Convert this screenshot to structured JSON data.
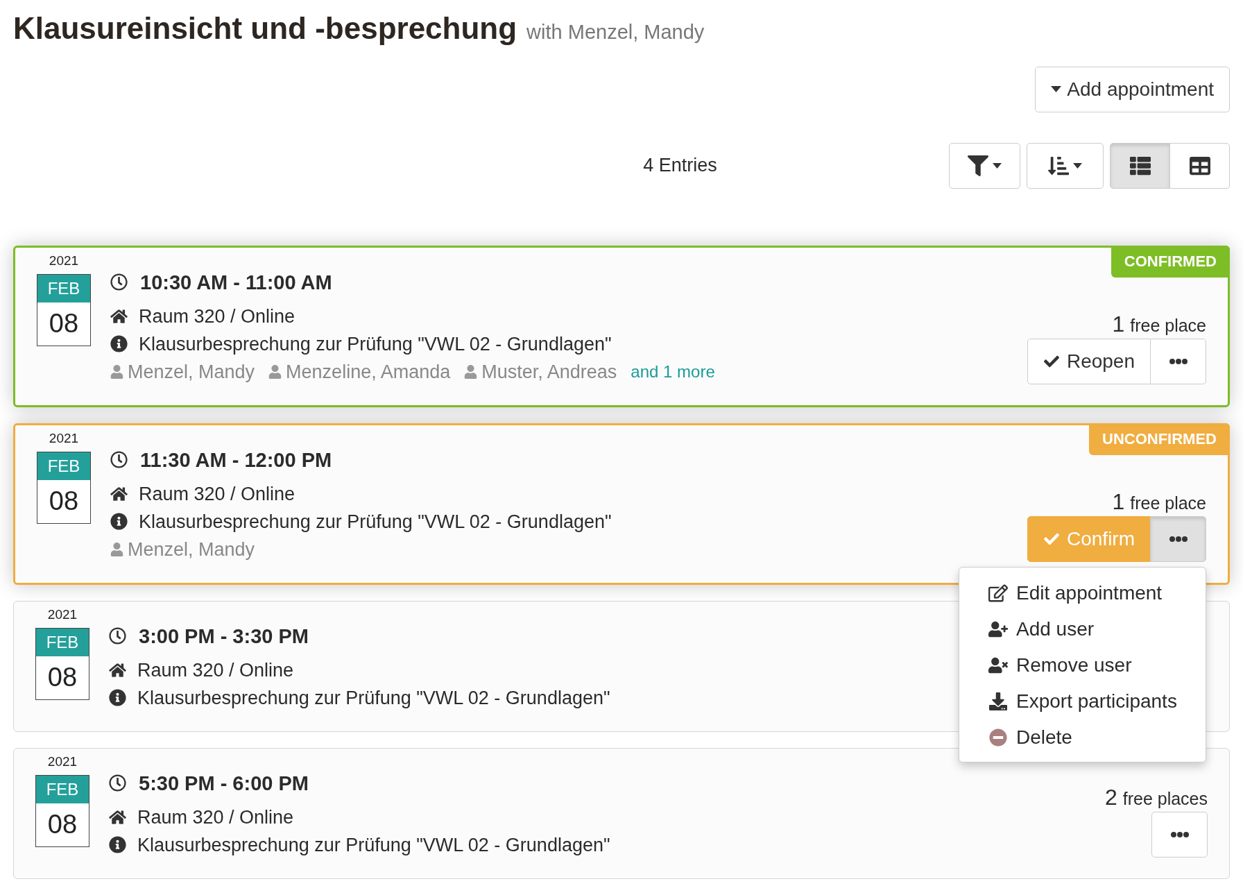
{
  "header": {
    "title": "Klausureinsicht und -besprechung",
    "subtitle": "with Menzel, Mandy"
  },
  "add_button": {
    "label": "Add appointment"
  },
  "toolbar": {
    "count": "4 Entries",
    "buttons": [
      {
        "kind": "filter"
      },
      {
        "kind": "sort"
      }
    ],
    "views": [
      {
        "kind": "list",
        "selected": true
      },
      {
        "kind": "table",
        "selected": false
      }
    ]
  },
  "appointments": [
    {
      "status": {
        "label": "CONFIRMED",
        "color": "#7dbd26"
      },
      "year": "2021",
      "month": "FEB",
      "day": "08",
      "time": "10:30 AM - 11:00 AM",
      "location": "Raum 320 / Online",
      "description": "Klausurbesprechung zur Prüfung \"VWL 02 - Grundlagen\"",
      "participants": [
        "Menzel, Mandy",
        "Menzeline, Amanda",
        "Muster, Andreas"
      ],
      "more": "and 1 more",
      "free": {
        "count": "1",
        "label": "free place"
      },
      "action": {
        "kind": "reopen",
        "label": "Reopen"
      },
      "menu_open": false
    },
    {
      "status": {
        "label": "UNCONFIRMED",
        "color": "#f0ad40"
      },
      "year": "2021",
      "month": "FEB",
      "day": "08",
      "time": "11:30 AM - 12:00 PM",
      "location": "Raum 320 / Online",
      "description": "Klausurbesprechung zur Prüfung \"VWL 02 - Grundlagen\"",
      "participants": [
        "Menzel, Mandy"
      ],
      "free": {
        "count": "1",
        "label": "free place"
      },
      "action": {
        "kind": "confirm",
        "label": "Confirm"
      },
      "menu_open": true,
      "menu": [
        {
          "kind": "edit",
          "label": "Edit appointment"
        },
        {
          "kind": "add-user",
          "label": "Add user"
        },
        {
          "kind": "remove-user",
          "label": "Remove user"
        },
        {
          "kind": "export",
          "label": "Export participants"
        },
        {
          "kind": "delete",
          "label": "Delete"
        }
      ]
    },
    {
      "year": "2021",
      "month": "FEB",
      "day": "08",
      "time": "3:00 PM - 3:30 PM",
      "location": "Raum 320 / Online",
      "description": "Klausurbesprechung zur Prüfung \"VWL 02 - Grundlagen\""
    },
    {
      "year": "2021",
      "month": "FEB",
      "day": "08",
      "time": "5:30 PM - 6:00 PM",
      "location": "Raum 320 / Online",
      "description": "Klausurbesprechung zur Prüfung \"VWL 02 - Grundlagen\"",
      "free": {
        "count": "2",
        "label": "free places"
      },
      "menu_open": false
    }
  ]
}
